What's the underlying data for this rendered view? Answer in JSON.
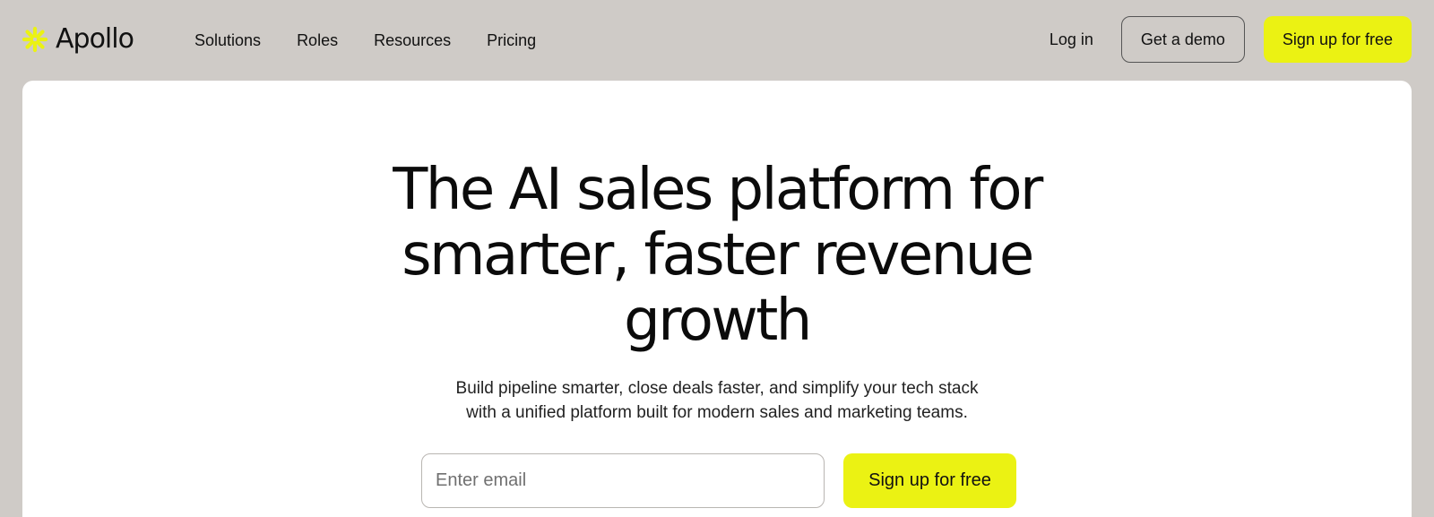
{
  "brand": {
    "name": "Apollo",
    "logo_icon": "asterisk-burst-icon",
    "accent_color": "#ebf213"
  },
  "nav": {
    "items": [
      {
        "label": "Solutions"
      },
      {
        "label": "Roles"
      },
      {
        "label": "Resources"
      },
      {
        "label": "Pricing"
      }
    ]
  },
  "header_actions": {
    "login_label": "Log in",
    "demo_label": "Get a demo",
    "signup_label": "Sign up for free"
  },
  "hero": {
    "title_lines": [
      "The AI sales platform for",
      "smarter, faster revenue",
      "growth"
    ],
    "subtitle_lines": [
      "Build pipeline smarter, close deals faster, and simplify your tech stack",
      "with a unified platform built for modern sales and marketing teams."
    ],
    "email_placeholder": "Enter email",
    "email_value": "",
    "signup_label": "Sign up for free"
  },
  "colors": {
    "page_background": "#cfcbc7",
    "card_background": "#ffffff",
    "text": "#111111"
  }
}
